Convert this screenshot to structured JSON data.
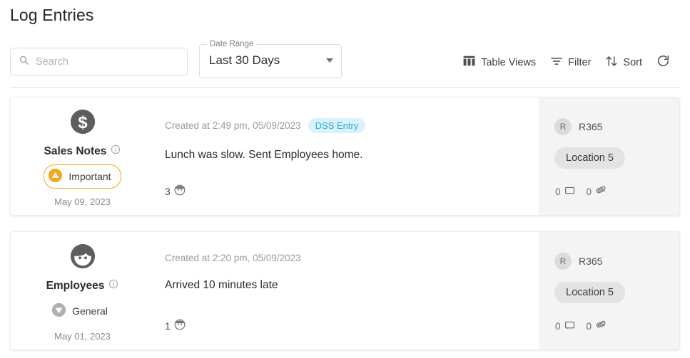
{
  "page": {
    "title": "Log Entries"
  },
  "search": {
    "placeholder": "Search",
    "value": "",
    "icon": "search-icon"
  },
  "date_range": {
    "label": "Date Range",
    "value": "Last 30 Days",
    "options": [
      "Last 30 Days"
    ],
    "arrow_icon": "chevron-down-icon"
  },
  "toolbar": {
    "table_views_label": "Table Views",
    "table_views_icon": "table-columns-icon",
    "filter_label": "Filter",
    "filter_icon": "filter-icon",
    "sort_label": "Sort",
    "sort_icon": "sort-arrows-icon",
    "refresh_icon": "refresh-icon"
  },
  "colors": {
    "important": "#f5a623",
    "general": "#b0b0b0",
    "entry_chip_text": "#29abe2",
    "entry_chip_bg": "#d9f2fb",
    "panel_bg": "#f4f4f4"
  },
  "cards": [
    {
      "type_name": "Sales Notes",
      "type_icon": "dollar-circle-icon",
      "priority_label": "Important",
      "priority_icon": "triangle-up-icon",
      "priority_kind": "important",
      "date": "May 09, 2023",
      "created_at": "Created at 2:49 pm, 05/09/2023",
      "entry_chip": "DSS Entry",
      "entry_text": "Lunch was slow. Sent Employees home.",
      "reaction_count": "3",
      "reaction_icon": "face-reaction-icon",
      "user_initial": "R",
      "user_name": "R365",
      "location": "Location 5",
      "comment_count": "0",
      "comment_icon": "comment-icon",
      "attachment_count": "0",
      "attachment_icon": "paperclip-icon"
    },
    {
      "type_name": "Employees",
      "type_icon": "person-face-icon",
      "priority_label": "General",
      "priority_icon": "triangle-down-icon",
      "priority_kind": "general",
      "date": "May 01, 2023",
      "created_at": "Created at 2:20 pm, 05/09/2023",
      "entry_chip": "",
      "entry_text": "Arrived 10 minutes late",
      "reaction_count": "1",
      "reaction_icon": "face-reaction-icon",
      "user_initial": "R",
      "user_name": "R365",
      "location": "Location 5",
      "comment_count": "0",
      "comment_icon": "comment-icon",
      "attachment_count": "0",
      "attachment_icon": "paperclip-icon"
    }
  ]
}
